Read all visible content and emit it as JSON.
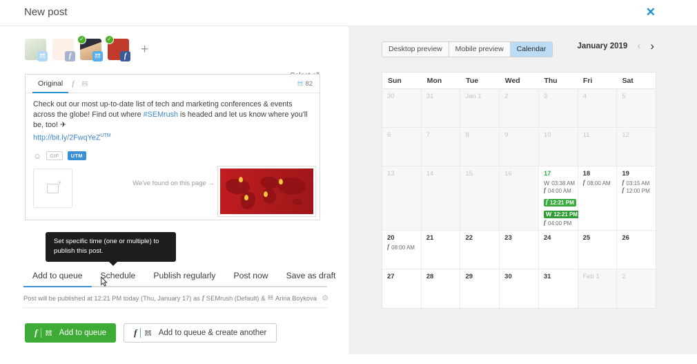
{
  "header": {
    "title": "New post",
    "close_icon": "close-icon"
  },
  "left": {
    "select_all": "Select all",
    "add_profile_icon": "plus-icon",
    "profiles": [
      {
        "name": "profile-twitter-1",
        "network": "twitter",
        "selected": false
      },
      {
        "name": "profile-facebook-1",
        "network": "facebook",
        "selected": false
      },
      {
        "name": "profile-twitter-2",
        "network": "twitter",
        "selected": true
      },
      {
        "name": "profile-facebook-2",
        "network": "facebook",
        "selected": true
      }
    ],
    "composer": {
      "tab_original": "Original",
      "tab_icon_facebook": "facebook-icon",
      "tab_icon_twitter": "twitter-icon",
      "char_count": "82",
      "char_count_icon": "twitter-icon",
      "text_part1": "Check out our most up-to-date list of tech and marketing conferences & events across the globe! Find out where ",
      "hashtag": "#SEMrush",
      "text_part2": " is headed and let us know where you'll be, too! ",
      "emoji": "✈",
      "link": "http://bit.ly/2FwqYeZ",
      "link_sup": "UTM",
      "tool_emoji": "emoji-icon",
      "tool_gif": "GIF",
      "tool_utm": "UTM",
      "media_found_label": "We've found on this page →",
      "media_add_icon": "add-image-icon",
      "media_thumb_name": "world-map-preview"
    },
    "tooltip": "Set specific time (one or multiple) to publish this post.",
    "action_tabs": [
      {
        "label": "Add to queue",
        "active": true
      },
      {
        "label": "Schedule",
        "active": false
      },
      {
        "label": "Publish regularly",
        "active": false
      },
      {
        "label": "Post now",
        "active": false
      },
      {
        "label": "Save as draft",
        "active": false
      }
    ],
    "publish_note_prefix": "Post will be published at 12:21 PM today (Thu, January 17) as",
    "publish_note_account1": "SEMrush (Default)",
    "publish_note_amp": "&",
    "publish_note_account2": "Arina Boykova",
    "publish_gear_icon": "gear-icon",
    "buttons": {
      "primary": "Add to queue",
      "secondary": "Add to queue & create another"
    }
  },
  "right": {
    "preview_tabs": [
      {
        "label": "Desktop preview",
        "active": false
      },
      {
        "label": "Mobile preview",
        "active": false
      },
      {
        "label": "Calendar",
        "active": true
      }
    ],
    "month_label": "January 2019",
    "prev_icon": "chevron-left-icon",
    "next_icon": "chevron-right-icon",
    "weekdays": [
      "Sun",
      "Mon",
      "Tue",
      "Wed",
      "Thu",
      "Fri",
      "Sat"
    ],
    "weeks": [
      [
        {
          "day": "30",
          "state": "muted",
          "events": []
        },
        {
          "day": "31",
          "state": "muted",
          "events": []
        },
        {
          "day": "Jan 1",
          "state": "past",
          "events": []
        },
        {
          "day": "2",
          "state": "past",
          "events": []
        },
        {
          "day": "3",
          "state": "past",
          "events": []
        },
        {
          "day": "4",
          "state": "past",
          "events": []
        },
        {
          "day": "5",
          "state": "past",
          "events": []
        }
      ],
      [
        {
          "day": "6",
          "state": "past",
          "events": []
        },
        {
          "day": "7",
          "state": "past",
          "events": []
        },
        {
          "day": "8",
          "state": "past",
          "events": []
        },
        {
          "day": "9",
          "state": "past",
          "events": []
        },
        {
          "day": "10",
          "state": "past",
          "events": []
        },
        {
          "day": "11",
          "state": "past",
          "events": []
        },
        {
          "day": "12",
          "state": "past",
          "events": []
        }
      ],
      [
        {
          "day": "13",
          "state": "past",
          "events": []
        },
        {
          "day": "14",
          "state": "past",
          "events": []
        },
        {
          "day": "15",
          "state": "past",
          "events": []
        },
        {
          "day": "16",
          "state": "past",
          "events": []
        },
        {
          "day": "17",
          "state": "today",
          "events": [
            {
              "network": "twitter",
              "time": "03:38 AM",
              "highlight": false
            },
            {
              "network": "facebook",
              "time": "04:00 AM",
              "highlight": false
            },
            {
              "network": "facebook",
              "time": "12:21 PM",
              "highlight": true
            },
            {
              "network": "twitter",
              "time": "12:21 PM",
              "highlight": true
            },
            {
              "network": "facebook",
              "time": "04:00 PM",
              "highlight": false
            }
          ]
        },
        {
          "day": "18",
          "state": "normal",
          "events": [
            {
              "network": "facebook",
              "time": "08:00 AM",
              "highlight": false
            }
          ]
        },
        {
          "day": "19",
          "state": "normal",
          "events": [
            {
              "network": "facebook",
              "time": "03:15 AM",
              "highlight": false
            },
            {
              "network": "facebook",
              "time": "12:00 PM",
              "highlight": false
            }
          ]
        }
      ],
      [
        {
          "day": "20",
          "state": "normal",
          "events": [
            {
              "network": "facebook",
              "time": "08:00 AM",
              "highlight": false
            }
          ]
        },
        {
          "day": "21",
          "state": "normal",
          "events": []
        },
        {
          "day": "22",
          "state": "normal",
          "events": []
        },
        {
          "day": "23",
          "state": "normal",
          "events": []
        },
        {
          "day": "24",
          "state": "normal",
          "events": []
        },
        {
          "day": "25",
          "state": "normal",
          "events": []
        },
        {
          "day": "26",
          "state": "normal",
          "events": []
        }
      ],
      [
        {
          "day": "27",
          "state": "normal",
          "events": []
        },
        {
          "day": "28",
          "state": "normal",
          "events": []
        },
        {
          "day": "29",
          "state": "normal",
          "events": []
        },
        {
          "day": "30",
          "state": "normal",
          "events": []
        },
        {
          "day": "31",
          "state": "normal",
          "events": []
        },
        {
          "day": "Feb 1",
          "state": "muted",
          "events": []
        },
        {
          "day": "2",
          "state": "muted",
          "events": []
        }
      ]
    ]
  },
  "colors": {
    "accent_blue": "#3a8fd6",
    "green": "#3eab36",
    "today_green": "#36a83b",
    "panel_gray": "#f1f1f1",
    "tooltip_bg": "#1e1e1e"
  }
}
